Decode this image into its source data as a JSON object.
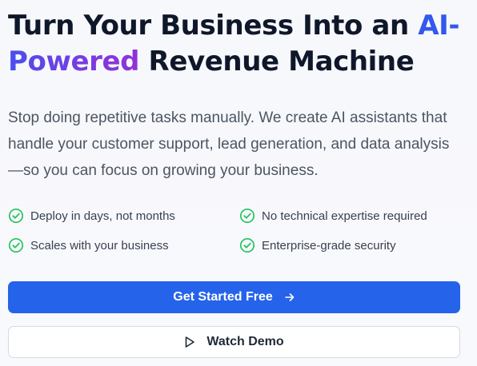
{
  "hero": {
    "headline_part1": "Turn Your Business Into an ",
    "headline_accent1": "AI-",
    "headline_accent2": "Powered",
    "headline_part2": " Revenue Machine",
    "subtext": "Stop doing repetitive tasks manually. We create AI assistants that handle your customer support, lead generation, and data analysis—so you can focus on growing your business."
  },
  "features": [
    {
      "label": "Deploy in days, not months",
      "icon": "check-circle-icon"
    },
    {
      "label": "No technical expertise required",
      "icon": "check-circle-icon"
    },
    {
      "label": "Scales with your business",
      "icon": "check-circle-icon"
    },
    {
      "label": "Enterprise-grade security",
      "icon": "check-circle-icon"
    }
  ],
  "cta": {
    "primary_label": "Get Started Free",
    "primary_icon": "arrow-right-icon",
    "secondary_label": "Watch Demo",
    "secondary_icon": "play-icon"
  },
  "colors": {
    "primary": "#2563eb",
    "accent_gradient_start": "#3b5bf0",
    "accent_gradient_end": "#8a35dc",
    "check_green": "#22c55e",
    "heading": "#0f172a",
    "body_text": "#4b5563"
  }
}
